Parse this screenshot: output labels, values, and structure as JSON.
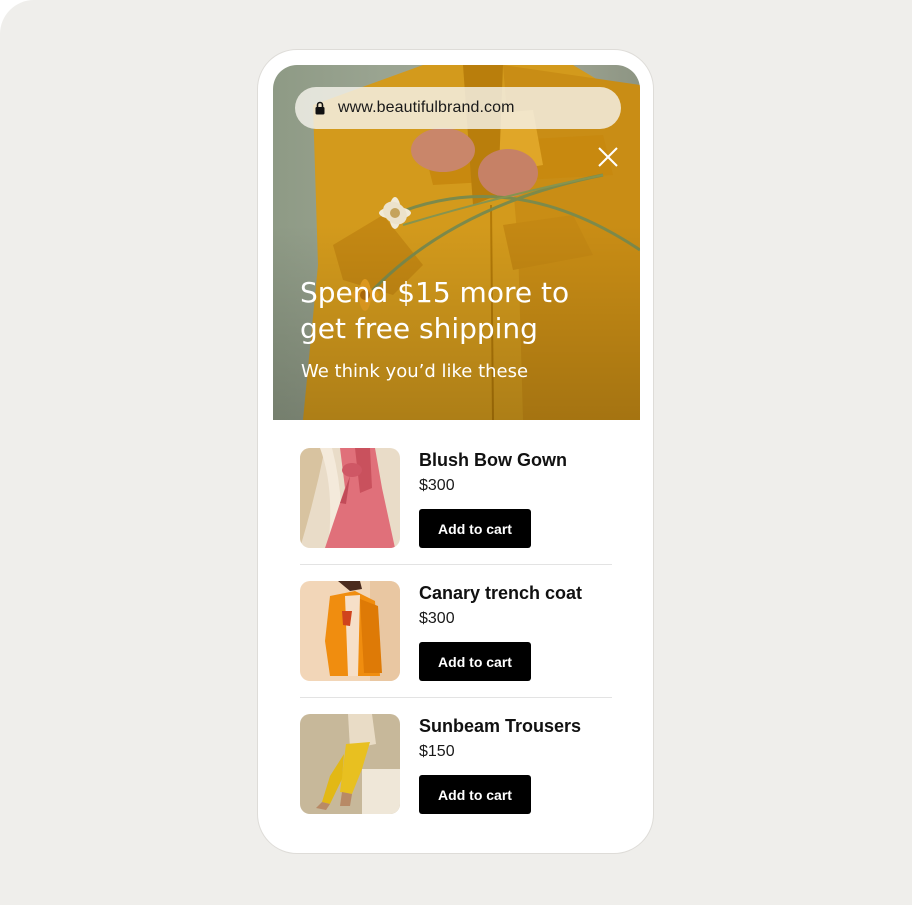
{
  "browser": {
    "url": "www.beautifulbrand.com",
    "lock_icon": "lock-icon",
    "close_icon": "close-icon"
  },
  "hero": {
    "headline": "Spend $15 more to get free shipping",
    "subhead": "We think you’d like these",
    "image": "model-in-mustard-coat-holding-flowers"
  },
  "products": [
    {
      "name": "Blush Bow Gown",
      "price": "$300",
      "cta": "Add to cart",
      "image": "pink-bow-gown"
    },
    {
      "name": "Canary trench coat",
      "price": "$300",
      "cta": "Add to cart",
      "image": "orange-trench-coat"
    },
    {
      "name": "Sunbeam Trousers",
      "price": "$150",
      "cta": "Add to cart",
      "image": "yellow-trousers"
    }
  ],
  "colors": {
    "background": "#efeeeb",
    "hero_green": "#9aa491",
    "coat_mustard": "#d39a1c",
    "button": "#000000",
    "button_text": "#ffffff"
  }
}
